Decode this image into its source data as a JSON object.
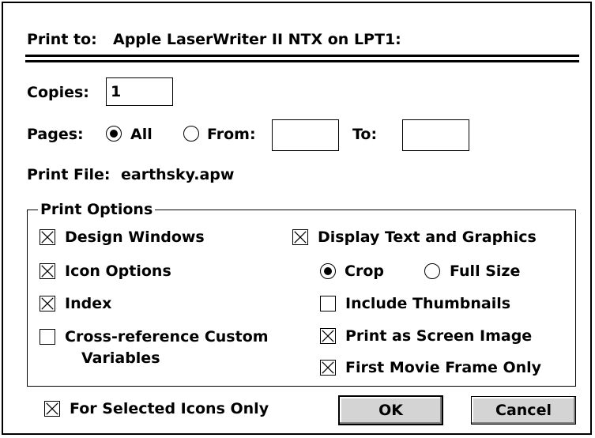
{
  "header": {
    "print_to_label": "Print to:",
    "printer": "Apple LaserWriter II NTX on LPT1:"
  },
  "copies": {
    "label": "Copies:",
    "value": "1"
  },
  "pages": {
    "label": "Pages:",
    "all_label": "All",
    "from_label": "From:",
    "from_value": "",
    "to_label": "To:",
    "to_value": "",
    "selected": "All"
  },
  "print_file": {
    "label": "Print File:",
    "value": "earthsky.apw"
  },
  "print_options": {
    "legend": "Print Options",
    "design_windows": {
      "label": "Design Windows",
      "checked": true
    },
    "icon_options": {
      "label": "Icon Options",
      "checked": true
    },
    "index": {
      "label": "Index",
      "checked": true
    },
    "cross_reference": {
      "label_line1": "Cross-reference Custom",
      "label_line2": "Variables",
      "checked": false
    },
    "display_text_graphics": {
      "label": "Display Text and Graphics",
      "checked": true
    },
    "crop_label": "Crop",
    "full_size_label": "Full Size",
    "size_selected": "Crop",
    "include_thumbnails": {
      "label": "Include Thumbnails",
      "checked": false
    },
    "print_as_screen_image": {
      "label": "Print as Screen Image",
      "checked": true
    },
    "first_movie_frame": {
      "label": "First Movie Frame Only",
      "checked": true
    }
  },
  "for_selected_icons": {
    "label": "For Selected Icons Only",
    "checked": true
  },
  "buttons": {
    "ok": "OK",
    "cancel": "Cancel"
  }
}
